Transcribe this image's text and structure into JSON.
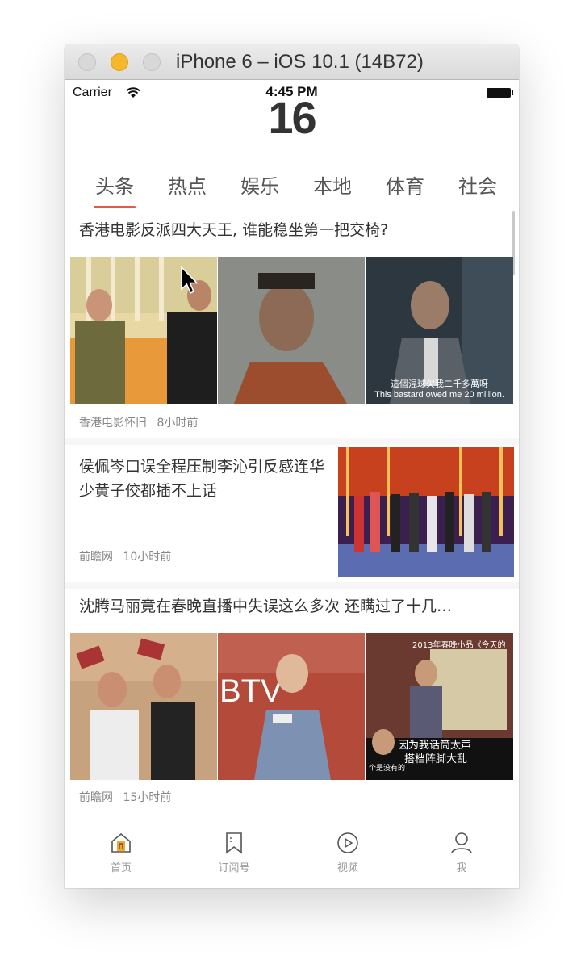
{
  "window": {
    "title": "iPhone 6 – iOS 10.1 (14B72)"
  },
  "status_bar": {
    "carrier": "Carrier",
    "time": "4:45 PM"
  },
  "refresh_indicator": "16",
  "tabs": [
    {
      "label": "头条",
      "active": true
    },
    {
      "label": "热点",
      "active": false
    },
    {
      "label": "娱乐",
      "active": false
    },
    {
      "label": "本地",
      "active": false
    },
    {
      "label": "体育",
      "active": false
    },
    {
      "label": "社会",
      "active": false
    }
  ],
  "articles": [
    {
      "title": "香港电影反派四大天王, 谁能稳坐第一把交椅?",
      "source": "香港电影怀旧",
      "time": "8小时前",
      "image_caption_cn": "這個混球欠我二千多萬呀",
      "image_caption_en": "This bastard owed me 20 million."
    },
    {
      "title": "侯佩岑口误全程压制李沁引反感连华少黄子佼都插不上话",
      "source": "前瞻网",
      "time": "10小时前"
    },
    {
      "title": "沈腾马丽竟在春晚直播中失误这么多次 还瞒过了十几…",
      "source": "前瞻网",
      "time": "15小时前",
      "image_text_1": "BTV",
      "image_text_2": "2013年春晚小品《今天的",
      "image_text_3": "因为我话筒太声",
      "image_text_4": "搭档阵脚大乱",
      "image_text_5": "个是没有的"
    }
  ],
  "tab_bar": [
    {
      "label": "首页",
      "icon": "home-icon"
    },
    {
      "label": "订阅号",
      "icon": "bookmark-icon"
    },
    {
      "label": "视频",
      "icon": "play-icon"
    },
    {
      "label": "我",
      "icon": "person-icon"
    }
  ],
  "colors": {
    "accent": "#e2584f",
    "home_icon": "#f5a623"
  }
}
